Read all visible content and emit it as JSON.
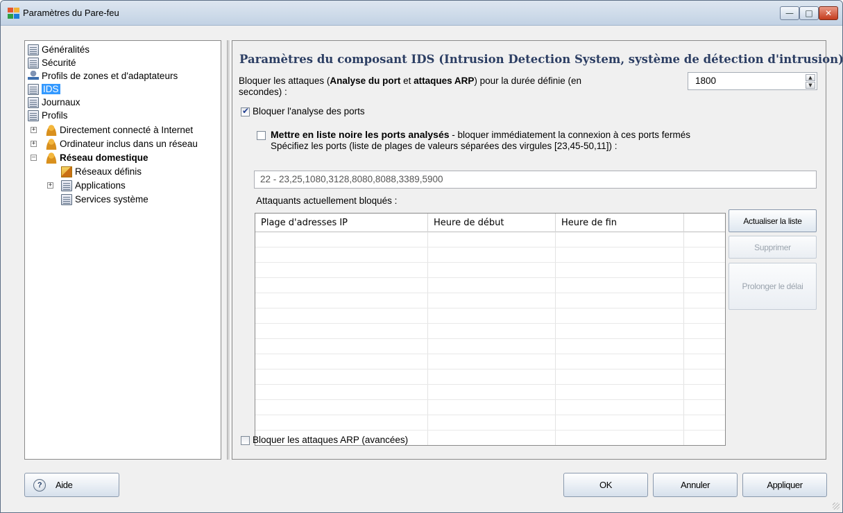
{
  "window": {
    "title": "Paramètres du Pare-feu",
    "minimize_icon": "minimize-icon",
    "maximize_icon": "maximize-icon",
    "close_icon": "close-icon"
  },
  "tree": {
    "items": [
      {
        "label": "Généralités",
        "icon": "document-icon"
      },
      {
        "label": "Sécurité",
        "icon": "document-icon"
      },
      {
        "label": "Profils de zones et d'adaptateurs",
        "icon": "network-icon"
      },
      {
        "label": "IDS",
        "icon": "document-icon",
        "selected": true
      },
      {
        "label": "Journaux",
        "icon": "document-icon"
      },
      {
        "label": "Profils",
        "icon": "document-icon"
      },
      {
        "label": "Directement connecté à Internet",
        "icon": "user-icon"
      },
      {
        "label": "Ordinateur inclus dans un réseau",
        "icon": "user-icon"
      },
      {
        "label": "Réseau domestique",
        "icon": "user-icon"
      },
      {
        "label": "Réseaux définis",
        "icon": "network-icon"
      },
      {
        "label": "Applications",
        "icon": "document-icon"
      },
      {
        "label": "Services système",
        "icon": "document-icon"
      }
    ]
  },
  "ids": {
    "title": "Paramètres du composant IDS (Intrusion Detection System, système de détection d'intrusion)",
    "block_duration": {
      "prefix": "Bloquer les attaques (",
      "bold1": "Analyse du port",
      "mid": " et ",
      "bold2": "attaques ARP",
      "suffix": ") pour la durée définie (en",
      "line2": "secondes) :",
      "value": "1800"
    },
    "block_port_scan": {
      "label": "Bloquer l'analyse des ports",
      "checked": true
    },
    "blacklist": {
      "bold": "Mettre en liste noire les ports analysés",
      "rest": " - bloquer immédiatement la connexion à ces ports fermés",
      "line2": "Spécifiez les ports (liste de plages de valeurs séparées des virgules [23,45-50,11]) :",
      "checked": false
    },
    "ports_value": "22 - 23,25,1080,3128,8080,8088,3389,5900",
    "blocked_label": "Attaquants actuellement bloqués :",
    "table": {
      "columns": [
        "Plage d'adresses IP",
        "Heure de début",
        "Heure de fin",
        ""
      ]
    },
    "buttons": {
      "refresh": "Actualiser la liste",
      "delete": "Supprimer",
      "extend": "Prolonger le délai"
    },
    "block_arp": {
      "label": "Bloquer les attaques ARP (avancées)",
      "checked": false
    }
  },
  "footer": {
    "help": "Aide",
    "ok": "OK",
    "cancel": "Annuler",
    "apply": "Appliquer"
  }
}
